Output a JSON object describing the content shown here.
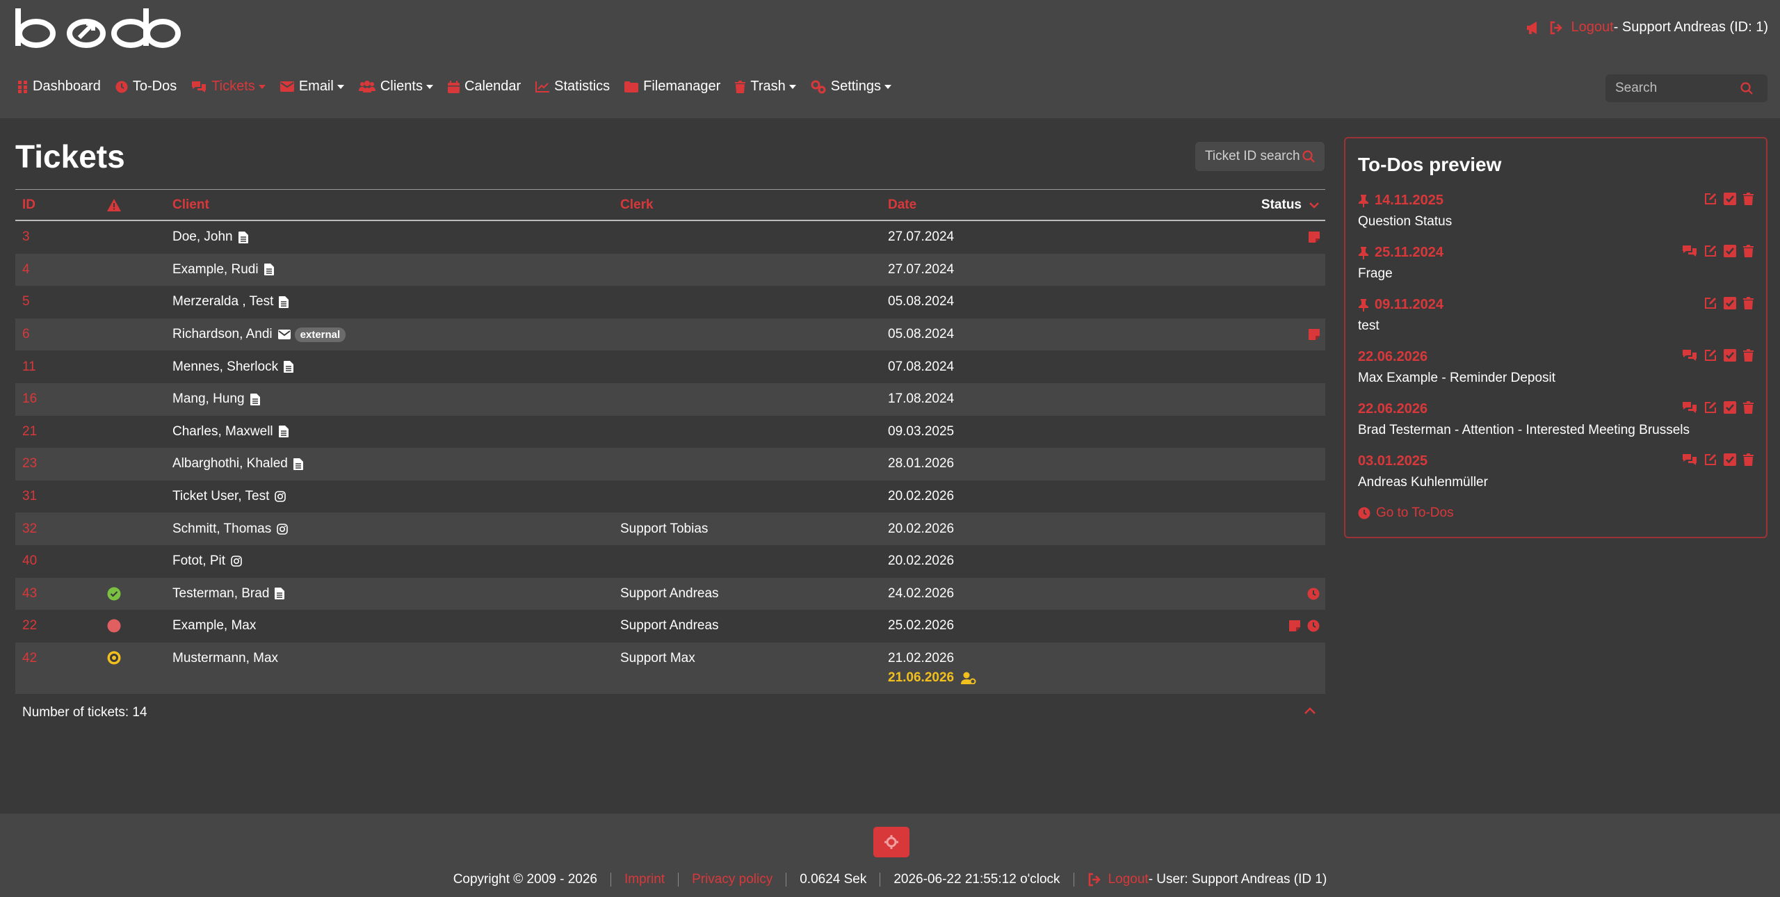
{
  "app": {
    "logo_text": "bodo"
  },
  "header": {
    "logout_label": "Logout",
    "user_text": " - Support Andreas (ID: 1)"
  },
  "nav": {
    "items": [
      {
        "label": "Dashboard",
        "icon": "dashboard-icon"
      },
      {
        "label": "To-Dos",
        "icon": "clock-icon"
      },
      {
        "label": "Tickets",
        "icon": "comments-icon",
        "active": true,
        "dropdown": true
      },
      {
        "label": "Email",
        "icon": "envelope-icon",
        "dropdown": true
      },
      {
        "label": "Clients",
        "icon": "users-icon",
        "dropdown": true
      },
      {
        "label": "Calendar",
        "icon": "calendar-icon"
      },
      {
        "label": "Statistics",
        "icon": "chart-icon"
      },
      {
        "label": "Filemanager",
        "icon": "folder-icon"
      },
      {
        "label": "Trash",
        "icon": "trash-icon",
        "dropdown": true
      },
      {
        "label": "Settings",
        "icon": "cogs-icon",
        "dropdown": true
      }
    ],
    "search_placeholder": "Search"
  },
  "main": {
    "title": "Tickets",
    "ticket_search_placeholder": "Ticket ID search",
    "columns": {
      "id": "ID",
      "client": "Client",
      "clerk": "Clerk",
      "date": "Date",
      "status": "Status"
    },
    "rows": [
      {
        "id": "3",
        "client": "Doe, John",
        "contact": "file",
        "clerk": "",
        "date": "27.07.2024",
        "status": [
          "note"
        ]
      },
      {
        "id": "4",
        "client": "Example, Rudi",
        "contact": "file",
        "clerk": "",
        "date": "27.07.2024",
        "status": []
      },
      {
        "id": "5",
        "client": "Merzeralda , Test",
        "contact": "file",
        "clerk": "",
        "date": "05.08.2024",
        "status": []
      },
      {
        "id": "6",
        "client": "Richardson, Andi",
        "contact": "envelope",
        "badge": "external",
        "clerk": "",
        "date": "05.08.2024",
        "status": [
          "note"
        ]
      },
      {
        "id": "11",
        "client": "Mennes, Sherlock",
        "contact": "file",
        "clerk": "",
        "date": "07.08.2024",
        "status": []
      },
      {
        "id": "16",
        "client": "Mang, Hung",
        "contact": "file",
        "clerk": "",
        "date": "17.08.2024",
        "status": []
      },
      {
        "id": "21",
        "client": "Charles, Maxwell",
        "contact": "file",
        "clerk": "",
        "date": "09.03.2025",
        "status": []
      },
      {
        "id": "23",
        "client": "Albarghothi, Khaled",
        "contact": "file",
        "clerk": "",
        "date": "28.01.2026",
        "status": []
      },
      {
        "id": "31",
        "client": "Ticket User, Test",
        "contact": "instagram",
        "clerk": "",
        "date": "20.02.2026",
        "status": []
      },
      {
        "id": "32",
        "client": "Schmitt, Thomas",
        "contact": "instagram",
        "clerk": "Support Tobias",
        "date": "20.02.2026",
        "status": []
      },
      {
        "id": "40",
        "client": "Fotot, Pit",
        "contact": "instagram",
        "clerk": "",
        "date": "20.02.2026",
        "status": []
      },
      {
        "id": "43",
        "prio": "green",
        "client": "Testerman, Brad",
        "contact": "file",
        "clerk": "Support Andreas",
        "date": "24.02.2026",
        "status": [
          "clock"
        ]
      },
      {
        "id": "22",
        "prio": "red",
        "client": "Example, Max",
        "contact": "",
        "clerk": "Support Andreas",
        "date": "25.02.2026",
        "status": [
          "note",
          "clock"
        ]
      },
      {
        "id": "42",
        "prio": "yellow",
        "client": "Mustermann, Max",
        "contact": "",
        "clerk": "Support Max",
        "date": "21.02.2026",
        "date2": "21.06.2026",
        "status": []
      }
    ],
    "count_text": "Number of tickets: 14"
  },
  "todos": {
    "title": "To-Dos preview",
    "items": [
      {
        "date": "14.11.2025",
        "text": "Question Status",
        "pinned": true,
        "comments": false
      },
      {
        "date": "25.11.2024",
        "text": "Frage",
        "pinned": true,
        "comments": true
      },
      {
        "date": "09.11.2024",
        "text": "test",
        "pinned": true,
        "comments": false
      },
      {
        "date": "22.06.2026",
        "text": "Max Example - Reminder Deposit",
        "pinned": false,
        "comments": true
      },
      {
        "date": "22.06.2026",
        "text": "Brad Testerman - Attention - Interested Meeting Brussels",
        "pinned": false,
        "comments": true
      },
      {
        "date": "03.01.2025",
        "text": "Andreas Kuhlenmüller",
        "pinned": false,
        "comments": true
      }
    ],
    "goto_label": "Go to To-Dos"
  },
  "footer": {
    "copyright": "Copyright © 2009 - 2026",
    "imprint": "Imprint",
    "privacy": "Privacy policy",
    "timing": "0.0624 Sek",
    "datetime": "2026-06-22 21:55:12 o'clock",
    "logout_label": "Logout",
    "user_text": " - User: Support Andreas (ID 1)"
  },
  "colors": {
    "accent": "#d9383a",
    "bg": "#3a393a",
    "bar": "#474647",
    "green": "#7ac142",
    "yellow": "#f2c01e"
  }
}
